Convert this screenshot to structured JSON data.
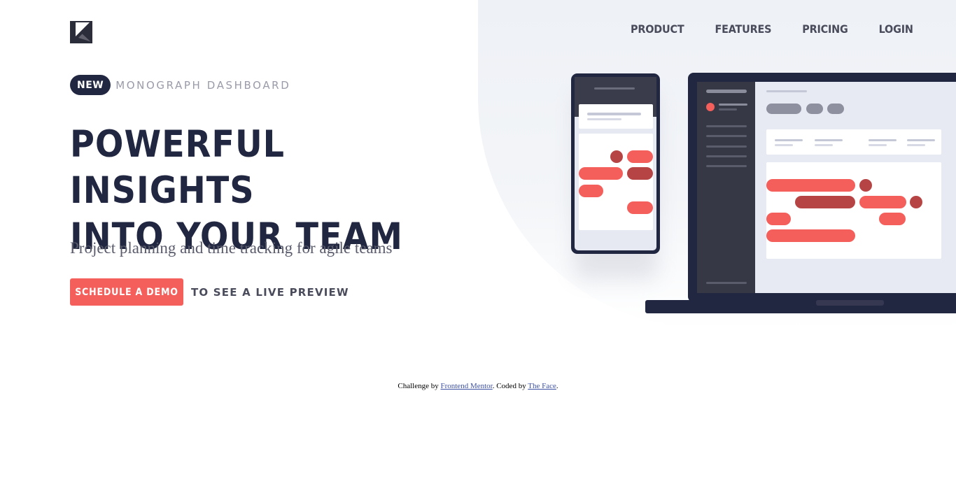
{
  "nav": {
    "items": [
      {
        "label": "PRODUCT"
      },
      {
        "label": "FEATURES"
      },
      {
        "label": "PRICING"
      },
      {
        "label": "LOGIN"
      }
    ]
  },
  "hero": {
    "badge": "NEW",
    "tag": "MONOGRAPH DASHBOARD",
    "headline_line1": "POWERFUL INSIGHTS",
    "headline_line2": "INTO YOUR TEAM",
    "subtitle": "Project planning and time tracking for agile teams",
    "cta_button": "SCHEDULE A DEMO",
    "cta_note": "TO SEE A LIVE PREVIEW"
  },
  "footer": {
    "prefix": "Challenge by",
    "link1": "Frontend Mentor",
    "middle": ". Coded by",
    "link2": "The Face",
    "suffix": "."
  },
  "colors": {
    "accent": "#f45f5b",
    "dark": "#222741",
    "text": "#4a4c5c",
    "background_shape": "#eef1f6"
  },
  "icons": {
    "logo": "monograph-logo-icon"
  }
}
